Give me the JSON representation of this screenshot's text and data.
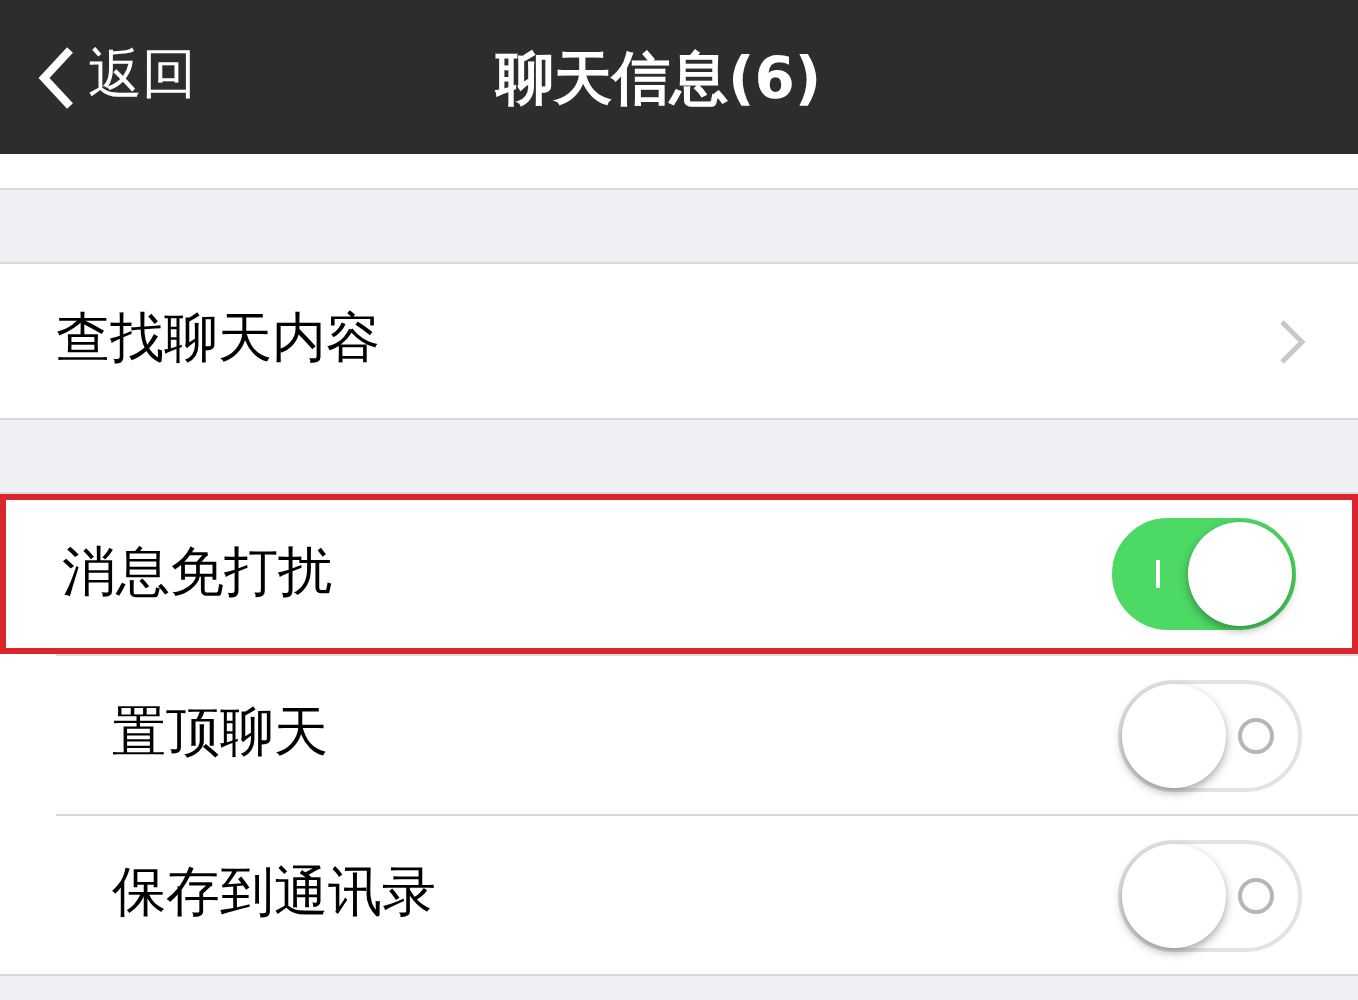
{
  "nav_bar": {
    "back_label": "返回",
    "title": "聊天信息(6)"
  },
  "search_row": {
    "label": "查找聊天内容"
  },
  "settings": [
    {
      "label": "消息免打扰",
      "on": true,
      "highlighted": true
    },
    {
      "label": "置顶聊天",
      "on": false,
      "highlighted": false
    },
    {
      "label": "保存到通讯录",
      "on": false,
      "highlighted": false
    }
  ]
}
